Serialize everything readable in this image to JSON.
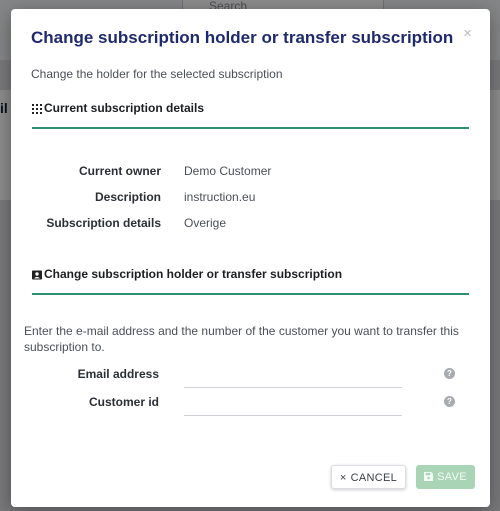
{
  "backdrop": {
    "search_placeholder": "Search",
    "partial_text": "il"
  },
  "modal": {
    "title": "Change subscription holder or transfer subscription",
    "intro": "Change the holder for the selected subscription",
    "close_glyph": "×"
  },
  "current_details": {
    "heading": "Current subscription details",
    "rows": [
      {
        "label": "Current owner",
        "value": "Demo Customer"
      },
      {
        "label": "Description",
        "value": "instruction.eu"
      },
      {
        "label": "Subscription details",
        "value": "Overige"
      }
    ]
  },
  "transfer": {
    "heading": "Change subscription holder or transfer subscription",
    "description": "Enter the e-mail address and the number of the customer you want to transfer this subscription to.",
    "fields": [
      {
        "label": "Email address",
        "value": "",
        "placeholder": ""
      },
      {
        "label": "Customer id",
        "value": "",
        "placeholder": ""
      }
    ],
    "help_glyph": "?"
  },
  "footer": {
    "cancel_label": "CANCEL",
    "cancel_icon": "×",
    "save_label": "SAVE"
  },
  "colors": {
    "title": "#1f2a6e",
    "section_rule": "#2f8f74",
    "save_button": "#a9d5b6"
  }
}
